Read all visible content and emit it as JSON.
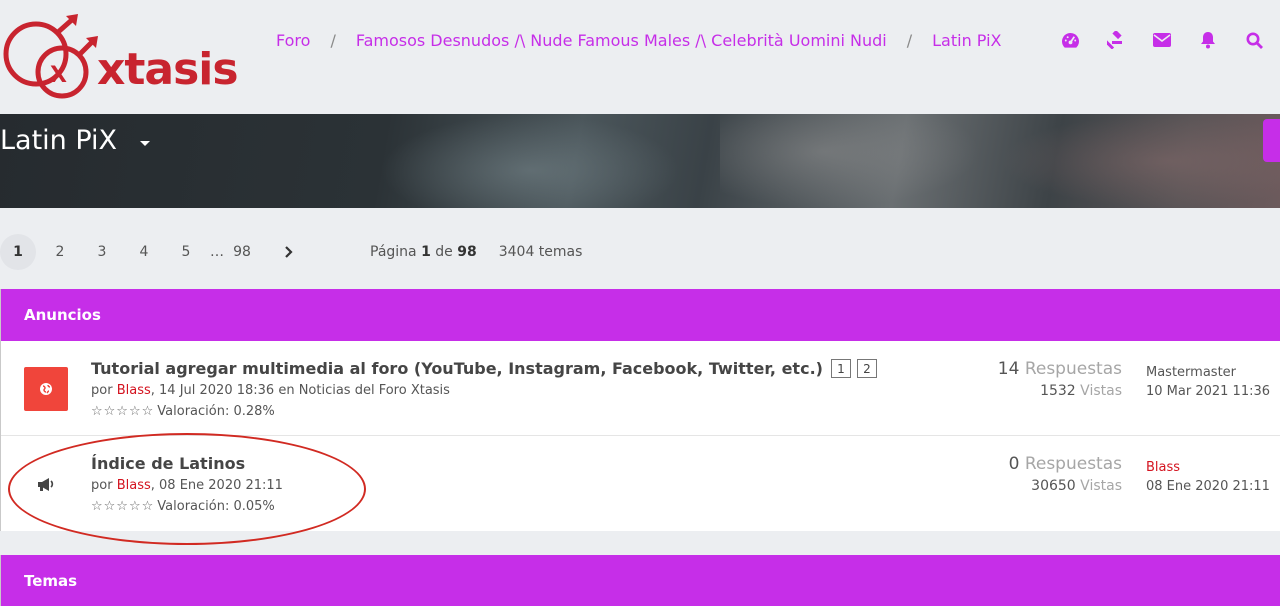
{
  "site": {
    "logo_text": "xtasis"
  },
  "breadcrumb": [
    {
      "label": "Foro"
    },
    {
      "label": "Famosos Desnudos /\\ Nude Famous Males /\\ Celebrità Uomini Nudi"
    },
    {
      "label": "Latin PiX"
    }
  ],
  "header_icons": [
    "dashboard-icon",
    "gavel-icon",
    "envelope-icon",
    "bell-icon",
    "search-icon"
  ],
  "colors": {
    "accent": "#c62ee8",
    "username": "#d4131f",
    "announce_icon": "#f0453b"
  },
  "forum_title": "Latin PiX",
  "pagination": {
    "pages": [
      "1",
      "2",
      "3",
      "4",
      "5"
    ],
    "ellipsis": "…",
    "last": "98",
    "current": "1",
    "info_prefix": "Página",
    "info_current": "1",
    "info_of": "de",
    "info_total": "98",
    "topics_count": "3404 temas"
  },
  "announcements": {
    "header": "Anuncios",
    "rows": [
      {
        "icon": "globe-icon",
        "title": "Tutorial agregar multimedia al foro (YouTube, Instagram, Facebook, Twitter, etc.)",
        "pages": [
          "1",
          "2"
        ],
        "by": "por",
        "author": "Blass",
        "date_text": ", 14 Jul 2020 18:36 en Noticias del Foro Xtasis",
        "stars": "☆☆☆☆☆",
        "rating": "Valoración: 0.28%",
        "replies": "14",
        "replies_label": "Respuestas",
        "views": "1532",
        "views_label": "Vistas",
        "last_user": "Mastermaster",
        "last_date": "10 Mar 2021 11:36"
      },
      {
        "icon": "bullhorn-icon",
        "title": "Índice de Latinos",
        "pages": [],
        "by": "por",
        "author": "Blass",
        "date_text": ", 08 Ene 2020 21:11",
        "stars": "☆☆☆☆☆",
        "rating": "Valoración: 0.05%",
        "replies": "0",
        "replies_label": "Respuestas",
        "views": "30650",
        "views_label": "Vistas",
        "last_user": "Blass",
        "last_date": "08 Ene 2020 21:11"
      }
    ]
  },
  "topics": {
    "header": "Temas"
  }
}
